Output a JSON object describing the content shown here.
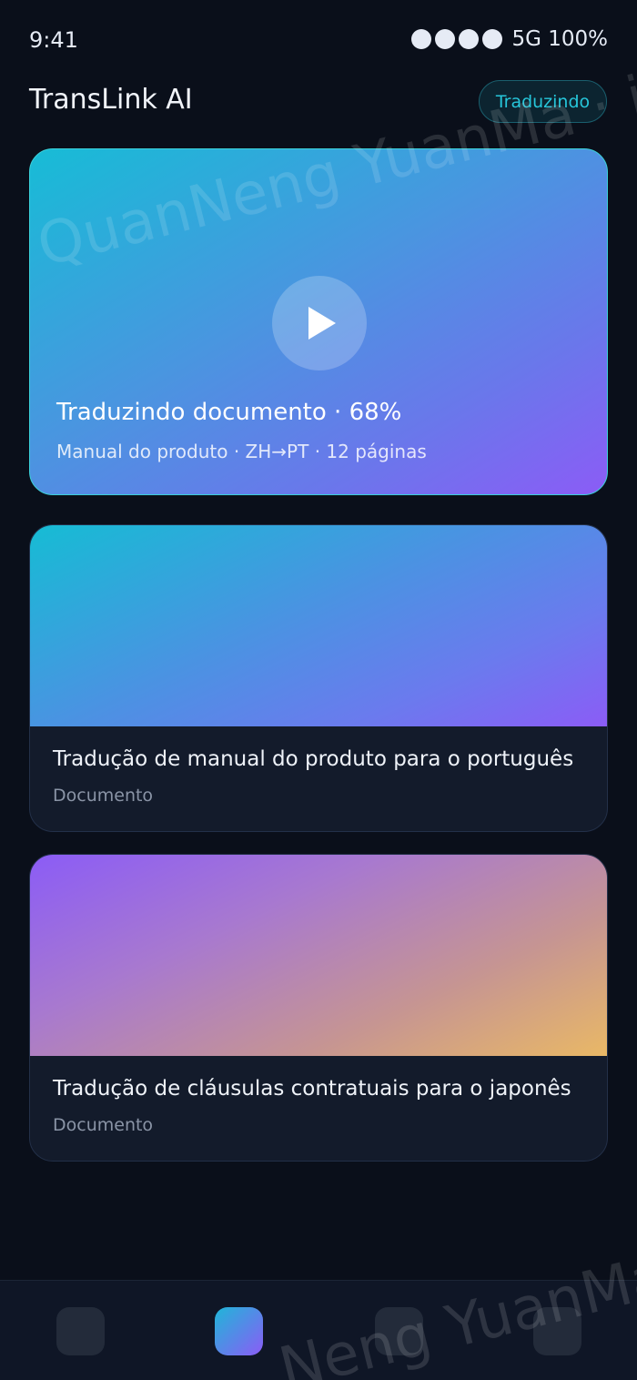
{
  "status_bar": {
    "time": "9:41",
    "network": "5G 100%"
  },
  "header": {
    "title": "TransLink AI",
    "status_badge": "Traduzindo"
  },
  "hero": {
    "title": "Traduzindo documento · 68%",
    "subtitle": "Manual do produto · ZH→PT · 12 páginas",
    "progress_percent": 68,
    "icon": "play-icon"
  },
  "cards": [
    {
      "title": "Tradução de manual do produto para o português",
      "type": "Documento"
    },
    {
      "title": "Tradução de cláusulas contratuais para o japonês",
      "type": "Documento"
    }
  ],
  "watermark": {
    "text_top": "QuanNeng YuanMa · in",
    "text_bottom": "Neng YuanMa"
  },
  "colors": {
    "background": "#0a0f1a",
    "accent": "#26c6da",
    "accent_purple": "#8b5cf6",
    "card": "#131b2b"
  },
  "bottom_nav": {
    "active_index": 1,
    "icons": [
      "nav-icon",
      "nav-icon",
      "nav-icon",
      "nav-icon"
    ]
  }
}
